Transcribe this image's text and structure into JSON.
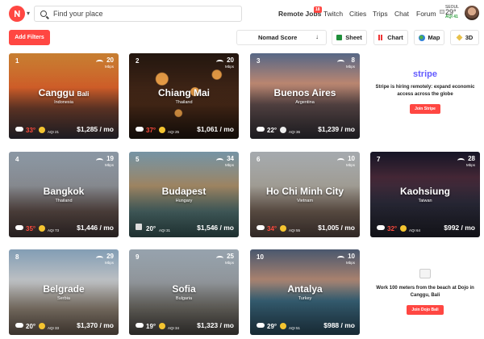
{
  "header": {
    "search_placeholder": "Find your place",
    "nav": {
      "remote_jobs": "Remote Jobs",
      "remote_jobs_badge": "18",
      "twitch": "Twitch",
      "cities": "Cities",
      "trips": "Trips",
      "chat": "Chat",
      "forum": "Forum"
    },
    "weather": {
      "city": "SEOUL",
      "temp": "29°",
      "aqi": "AQI 41"
    }
  },
  "toolbar": {
    "add_filters": "Add Filters",
    "sort": "Nomad Score",
    "sort_arrow": "↓",
    "sheet": "Sheet",
    "chart": "Chart",
    "map": "Map",
    "three_d": "3D"
  },
  "cards": [
    {
      "rank": "1",
      "city": "Canggu",
      "city_suffix": "Bali",
      "country": "Indonesia",
      "mbps": "20",
      "temp": "33°",
      "temp_hot": true,
      "aqi": "AQI 21",
      "cost": "$1,285 / mo"
    },
    {
      "rank": "2",
      "city": "Chiang Mai",
      "city_suffix": "",
      "country": "Thailand",
      "mbps": "20",
      "temp": "37°",
      "temp_hot": true,
      "aqi": "AQI 25",
      "cost": "$1,061 / mo"
    },
    {
      "rank": "3",
      "city": "Buenos Aires",
      "city_suffix": "",
      "country": "Argentina",
      "mbps": "8",
      "temp": "22°",
      "temp_hot": false,
      "aqi": "AQI 36",
      "cost": "$1,239 / mo"
    },
    {
      "rank": "4",
      "city": "Bangkok",
      "city_suffix": "",
      "country": "Thailand",
      "mbps": "19",
      "temp": "35°",
      "temp_hot": true,
      "aqi": "AQI 73",
      "cost": "$1,446 / mo"
    },
    {
      "rank": "5",
      "city": "Budapest",
      "city_suffix": "",
      "country": "Hungary",
      "mbps": "34",
      "temp": "20°",
      "temp_hot": false,
      "aqi": "AQI 31",
      "cost": "$1,546 / mo"
    },
    {
      "rank": "6",
      "city": "Ho Chi Minh City",
      "city_suffix": "",
      "country": "Vietnam",
      "mbps": "10",
      "temp": "34°",
      "temp_hot": true,
      "aqi": "AQI 55",
      "cost": "$1,005 / mo"
    },
    {
      "rank": "7",
      "city": "Kaohsiung",
      "city_suffix": "",
      "country": "Taiwan",
      "mbps": "28",
      "temp": "32°",
      "temp_hot": true,
      "aqi": "AQI 64",
      "cost": "$992 / mo"
    },
    {
      "rank": "8",
      "city": "Belgrade",
      "city_suffix": "",
      "country": "Serbia",
      "mbps": "29",
      "temp": "20°",
      "temp_hot": false,
      "aqi": "AQI 33",
      "cost": "$1,370 / mo"
    },
    {
      "rank": "9",
      "city": "Sofia",
      "city_suffix": "",
      "country": "Bulgaria",
      "mbps": "25",
      "temp": "19°",
      "temp_hot": false,
      "aqi": "AQI 34",
      "cost": "$1,323 / mo"
    },
    {
      "rank": "10",
      "city": "Antalya",
      "city_suffix": "",
      "country": "Turkey",
      "mbps": "10",
      "temp": "29°",
      "temp_hot": false,
      "aqi": "AQI 51",
      "cost": "$988 / mo"
    }
  ],
  "ads": {
    "stripe": {
      "logo": "stripe",
      "text": "Stripe is hiring remotely: expand economic access across the globe",
      "button": "Join Stripe"
    },
    "dojo": {
      "text": "Work 100 meters from the beach at Dojo in Canggu, Bali",
      "button": "Join Dojo Bali"
    }
  },
  "colors": {
    "accent": "#ff4742",
    "stripe": "#635bff",
    "hot_temp": "#ff4a3d"
  }
}
